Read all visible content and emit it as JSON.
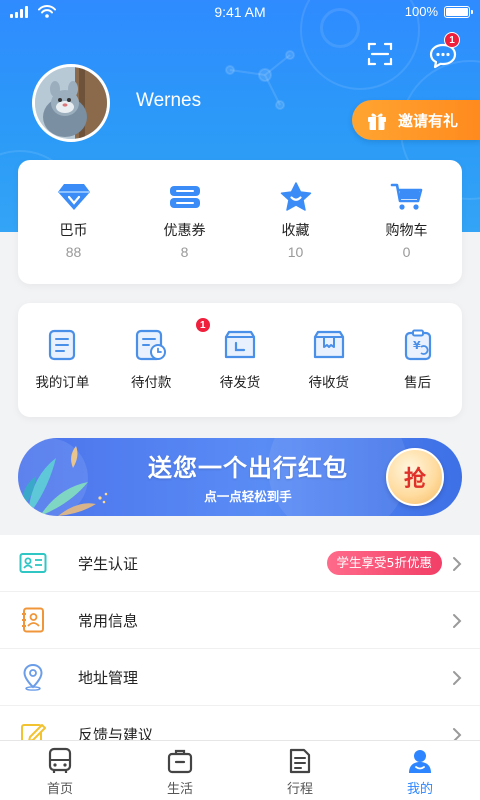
{
  "status_bar": {
    "time": "9:41 AM",
    "battery": "100%",
    "battery_level": 1.0
  },
  "header": {
    "username": "Wernes",
    "message_badge": "1",
    "invite_label": "邀请有礼"
  },
  "stats": [
    {
      "label": "巴币",
      "value": "88",
      "icon": "diamond-icon"
    },
    {
      "label": "优惠券",
      "value": "8",
      "icon": "coupon-icon"
    },
    {
      "label": "收藏",
      "value": "10",
      "icon": "star-icon"
    },
    {
      "label": "购物车",
      "value": "0",
      "icon": "cart-icon"
    }
  ],
  "orders": [
    {
      "label": "我的订单",
      "icon": "order-list-icon",
      "badge": ""
    },
    {
      "label": "待付款",
      "icon": "pending-payment-icon",
      "badge": "1"
    },
    {
      "label": "待发货",
      "icon": "pending-shipment-icon",
      "badge": ""
    },
    {
      "label": "待收货",
      "icon": "pending-receipt-icon",
      "badge": ""
    },
    {
      "label": "售后",
      "icon": "after-sales-icon",
      "badge": ""
    }
  ],
  "banner": {
    "title": "送您一个出行红包",
    "subtitle": "点一点轻松到手",
    "button": "抢"
  },
  "menu": [
    {
      "label": "学生认证",
      "icon": "student-id-icon",
      "promo": "学生享受5折优惠"
    },
    {
      "label": "常用信息",
      "icon": "contact-card-icon",
      "promo": ""
    },
    {
      "label": "地址管理",
      "icon": "location-pin-icon",
      "promo": ""
    },
    {
      "label": "反馈与建议",
      "icon": "feedback-icon",
      "promo": ""
    }
  ],
  "tabs": [
    {
      "label": "首页",
      "icon": "bus-icon",
      "active": false
    },
    {
      "label": "生活",
      "icon": "briefcase-icon",
      "active": false
    },
    {
      "label": "行程",
      "icon": "itinerary-icon",
      "active": false
    },
    {
      "label": "我的",
      "icon": "profile-icon",
      "active": true
    }
  ],
  "colors": {
    "primary": "#2d86ff",
    "header_gradient_top": "#2f8bff",
    "invite_orange": "#ff9a28",
    "badge_red": "#f0203c",
    "promo_pink": "#f23f67",
    "banner_blue": "#5a8cf5"
  }
}
